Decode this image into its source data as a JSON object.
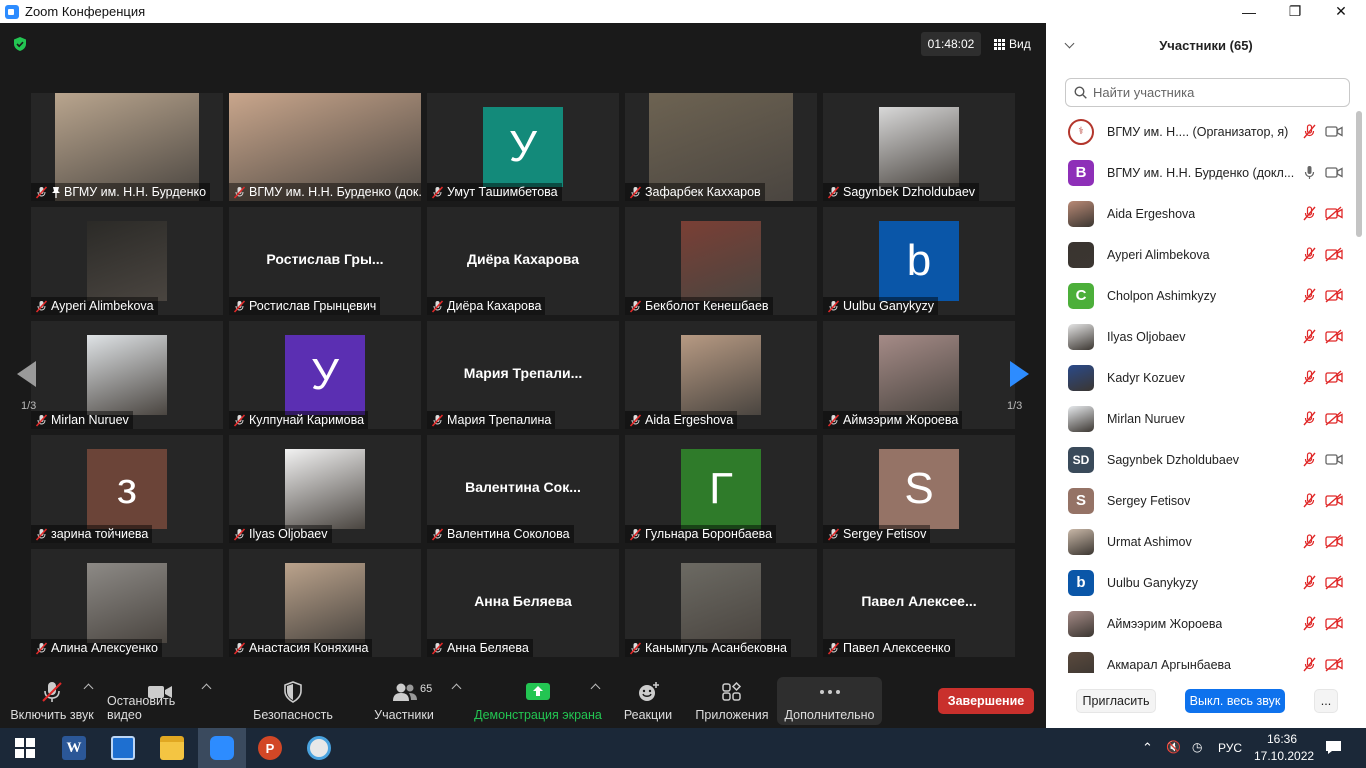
{
  "window": {
    "title": "Zoom Конференция",
    "minimize_icon": "minimize-icon",
    "restore_icon": "restore-icon",
    "close_icon": "close-icon"
  },
  "meeting": {
    "timer": "01:48:02",
    "view_label": "Вид",
    "page_left": "1/3",
    "page_right": "1/3"
  },
  "tiles": [
    {
      "label": "ВГМУ им. Н.Н. Бурденко",
      "kind": "photo",
      "pinned": true,
      "photo_color": "#b9a58e"
    },
    {
      "label": "ВГМУ им. Н.Н. Бурденко (док...",
      "kind": "photo",
      "active": true,
      "photo_color": "#c9a68c"
    },
    {
      "label": "Умут Ташимбетова",
      "kind": "avatar",
      "letter": "У",
      "color": "#138a7a"
    },
    {
      "label": "Зафарбек Каххаров",
      "kind": "photo",
      "photo_color": "#6d6352"
    },
    {
      "label": "Sagynbek Dzholdubaev",
      "kind": "photo",
      "photo_color": "#d8d8d8"
    },
    {
      "label": "Ayperi Alimbekova",
      "kind": "photo",
      "photo_color": "#2b2a27"
    },
    {
      "label": "Ростислав Грынцевич",
      "kind": "name",
      "display": "Ростислав  Гры..."
    },
    {
      "label": "Диёра Кахарова",
      "kind": "name",
      "display": "Диёра Кахарова"
    },
    {
      "label": "Бекболот Кенешбаев",
      "kind": "photo",
      "photo_color": "#7a3f35"
    },
    {
      "label": "Uulbu Ganykyzy",
      "kind": "avatar",
      "letter": "b",
      "color": "#0a56a8"
    },
    {
      "label": "Mirlan Nuruev",
      "kind": "photo",
      "photo_color": "#dfe3e6"
    },
    {
      "label": "Кулпунай Каримова",
      "kind": "avatar",
      "letter": "У",
      "color": "#5b2fb2"
    },
    {
      "label": "Мария Трепалина",
      "kind": "name",
      "display": "Мария  Трепали..."
    },
    {
      "label": "Aida Ergeshova",
      "kind": "photo",
      "photo_color": "#b79a83"
    },
    {
      "label": "Аймээрим Жороева",
      "kind": "photo",
      "photo_color": "#a58b87"
    },
    {
      "label": "зарина тойчиева",
      "kind": "avatar",
      "letter": "з",
      "color": "#6b4438"
    },
    {
      "label": "Ilyas Oljobaev",
      "kind": "photo",
      "photo_color": "#f2f2f2"
    },
    {
      "label": "Валентина Соколова",
      "kind": "name",
      "display": "Валентина  Сок..."
    },
    {
      "label": "Гульнара Боронбаева",
      "kind": "avatar",
      "letter": "Г",
      "color": "#2f7b2a"
    },
    {
      "label": "Sergey Fetisov",
      "kind": "avatar",
      "letter": "S",
      "color": "#957366"
    },
    {
      "label": "Алина Алексуенко",
      "kind": "photo",
      "photo_color": "#8d8a86"
    },
    {
      "label": "Анастасия Коняхина",
      "kind": "photo",
      "photo_color": "#bba38c"
    },
    {
      "label": "Анна Беляева",
      "kind": "name",
      "display": "Анна Беляева"
    },
    {
      "label": "Канымгуль Асанбековна",
      "kind": "photo",
      "photo_color": "#6c6a63"
    },
    {
      "label": "Павел Алексеенко",
      "kind": "name",
      "display": "Павел  Алексее..."
    }
  ],
  "toolbar": {
    "mute_label": "Включить звук",
    "video_label": "Остановить видео",
    "security_label": "Безопасность",
    "participants_label": "Участники",
    "participants_count": "65",
    "share_label": "Демонстрация экрана",
    "reactions_label": "Реакции",
    "apps_label": "Приложения",
    "more_label": "Дополнительно",
    "end_label": "Завершение",
    "share_color": "#23c552",
    "end_color": "#c9302c"
  },
  "panel": {
    "title": "Участники (65)",
    "search_placeholder": "Найти участника",
    "participants": [
      {
        "name": "ВГМУ им. Н....  (Организатор, я)",
        "avatar": "logo",
        "mic": "off",
        "cam": "on"
      },
      {
        "name": "ВГМУ им. Н.Н. Бурденко (докл...",
        "letter": "B",
        "color": "#8e2fb8",
        "mic": "on",
        "cam": "on"
      },
      {
        "name": "Aida Ergeshova",
        "avatar": "photo",
        "photo_color": "#b98a76",
        "mic": "off",
        "cam": "off"
      },
      {
        "name": "Ayperi Alimbekova",
        "avatar": "photo",
        "photo_color": "#3a3430",
        "mic": "off",
        "cam": "off"
      },
      {
        "name": "Cholpon Ashimkyzy",
        "letter": "C",
        "color": "#4caf3a",
        "mic": "off",
        "cam": "off"
      },
      {
        "name": "Ilyas Oljobaev",
        "avatar": "photo",
        "photo_color": "#e4e4e4",
        "mic": "off",
        "cam": "off"
      },
      {
        "name": "Kadyr Kozuev",
        "avatar": "photo",
        "photo_color": "#2a4a8a",
        "mic": "off",
        "cam": "off"
      },
      {
        "name": "Mirlan Nuruev",
        "avatar": "photo",
        "photo_color": "#e6e9ec",
        "mic": "off",
        "cam": "off"
      },
      {
        "name": "Sagynbek Dzholdubaev",
        "letter": "SD",
        "color": "#3a4a5a",
        "mic": "off",
        "cam": "on"
      },
      {
        "name": "Sergey Fetisov",
        "letter": "S",
        "color": "#957366",
        "mic": "off",
        "cam": "off"
      },
      {
        "name": "Urmat Ashimov",
        "avatar": "photo",
        "photo_color": "#c9b8a8",
        "mic": "off",
        "cam": "off"
      },
      {
        "name": "Uulbu Ganykyzy",
        "letter": "b",
        "color": "#0a56a8",
        "mic": "off",
        "cam": "off"
      },
      {
        "name": "Аймээрим Жороева",
        "avatar": "photo",
        "photo_color": "#a58b87",
        "mic": "off",
        "cam": "off"
      },
      {
        "name": "Акмарал Аргынбаева",
        "avatar": "photo",
        "photo_color": "#5b4a3e",
        "mic": "off",
        "cam": "off"
      }
    ],
    "invite_label": "Пригласить",
    "mute_all_label": "Выкл. весь звук",
    "more_label": "..."
  },
  "taskbar": {
    "language": "РУС",
    "time": "16:36",
    "date": "17.10.2022",
    "apps": [
      "windows-start-icon",
      "word-icon",
      "calculator-icon",
      "file-explorer-icon",
      "zoom-icon",
      "powerpoint-icon",
      "paint-icon"
    ]
  }
}
